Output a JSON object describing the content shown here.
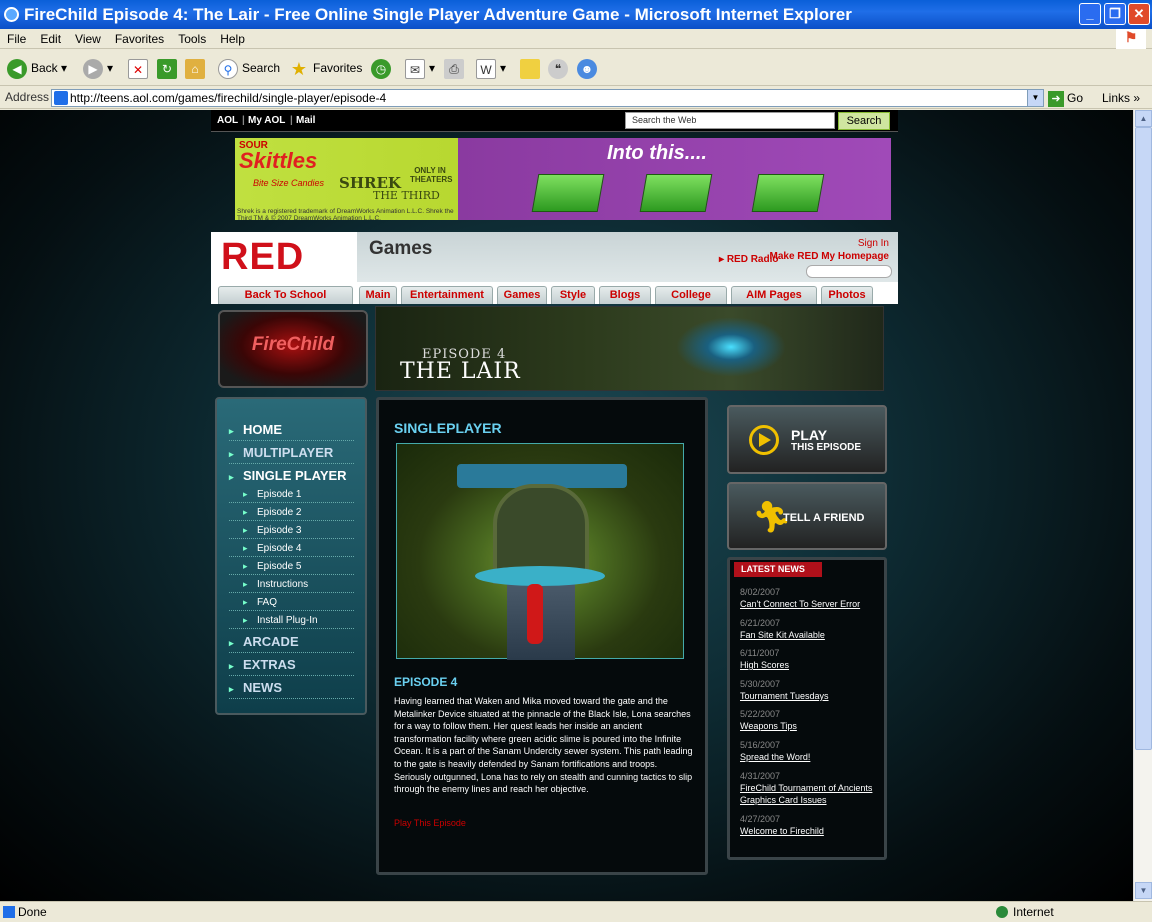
{
  "window": {
    "title": "FireChild Episode 4: The Lair - Free Online Single Player Adventure Game - Microsoft Internet Explorer"
  },
  "menu": [
    "File",
    "Edit",
    "View",
    "Favorites",
    "Tools",
    "Help"
  ],
  "toolbar": {
    "back": "Back",
    "search": "Search",
    "favorites": "Favorites"
  },
  "address": {
    "label": "Address",
    "url": "http://teens.aol.com/games/firechild/single-player/episode-4",
    "go": "Go",
    "links": "Links"
  },
  "status": {
    "text": "Done",
    "zone": "Internet"
  },
  "aol": {
    "links": [
      "AOL",
      "My AOL",
      "Mail"
    ],
    "search_placeholder": "Search the Web",
    "search_button": "Search"
  },
  "ad": {
    "sour": "SOUR",
    "brand": "Skittles",
    "tagline": "Bite Size Candies",
    "movie": "SHREK",
    "movie2": "THE THIRD",
    "only": "ONLY IN THEATERS",
    "legal": "Shrek is a registered trademark of DreamWorks Animation L.L.C. Shrek the Third TM & © 2007 DreamWorks Animation L.L.C.",
    "into": "Into this...."
  },
  "red": {
    "logo": "RED",
    "section": "Games",
    "sign_in": "Sign In",
    "make_home": "Make RED My Homepage",
    "radio": "RED Radio",
    "back_school": "Back To School",
    "tabs": [
      "Main",
      "Entertainment",
      "Games",
      "Style",
      "Blogs",
      "College",
      "AIM Pages",
      "Photos"
    ]
  },
  "firechild": {
    "logo": "FireChild",
    "episode": "EPISODE 4",
    "episode_title": "THE LAIR"
  },
  "nav": {
    "home": "HOME",
    "multiplayer": "MULTIPLAYER",
    "single": "SINGLE PLAYER",
    "sub": [
      "Episode 1",
      "Episode 2",
      "Episode 3",
      "Episode 4",
      "Episode 5",
      "Instructions",
      "FAQ",
      "Install Plug-In"
    ],
    "arcade": "ARCADE",
    "extras": "EXTRAS",
    "news": "NEWS"
  },
  "main": {
    "heading": "SINGLEPLAYER",
    "episode": "EPISODE 4",
    "description": "Having learned that Waken and Mika moved toward the gate and the Metalinker Device situated at the pinnacle of the Black Isle, Lona searches for a way to follow them. Her quest leads her inside an ancient transformation facility where green acidic slime is poured into the Infinite Ocean. It is a part of the Sanam Undercity sewer system. This path leading to the gate is heavily defended by Sanam fortifications and troops. Seriously outgunned, Lona has to rely on stealth and cunning tactics to slip through the enemy lines and reach her objective.",
    "play_link": "Play This Episode"
  },
  "side": {
    "play1": "PLAY",
    "play2": "THIS EPISODE",
    "tell": "TELL A FRIEND",
    "news_head": "LATEST NEWS"
  },
  "news": [
    {
      "date": "8/02/2007",
      "title": "Can't Connect To Server Error"
    },
    {
      "date": "6/21/2007",
      "title": "Fan Site Kit Available"
    },
    {
      "date": "6/11/2007",
      "title": "High Scores"
    },
    {
      "date": "5/30/2007",
      "title": "Tournament Tuesdays"
    },
    {
      "date": "5/22/2007",
      "title": "Weapons Tips"
    },
    {
      "date": "5/16/2007",
      "title": "Spread the Word!"
    },
    {
      "date": "4/31/2007",
      "title": "FireChild Tournament of Ancients Graphics Card Issues"
    },
    {
      "date": "4/27/2007",
      "title": "Welcome to Firechild"
    }
  ]
}
